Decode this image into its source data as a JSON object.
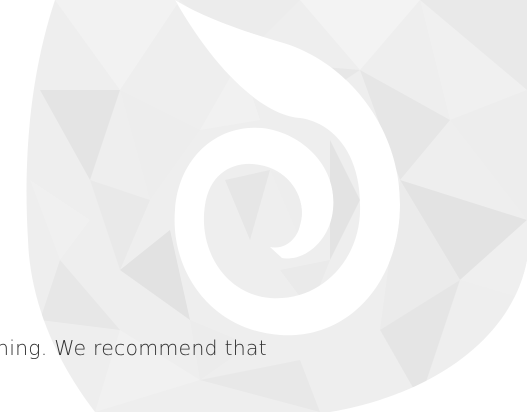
{
  "background": {
    "watermark_icon": "polygonal-spiral-logo-icon",
    "watermark_colors": [
      "#f1f1f1",
      "#ebebeb",
      "#e4e4e4",
      "#dcdcdc"
    ],
    "page_color": "#ffffff"
  },
  "content": {
    "notice_text": "ning. We recommend that"
  }
}
